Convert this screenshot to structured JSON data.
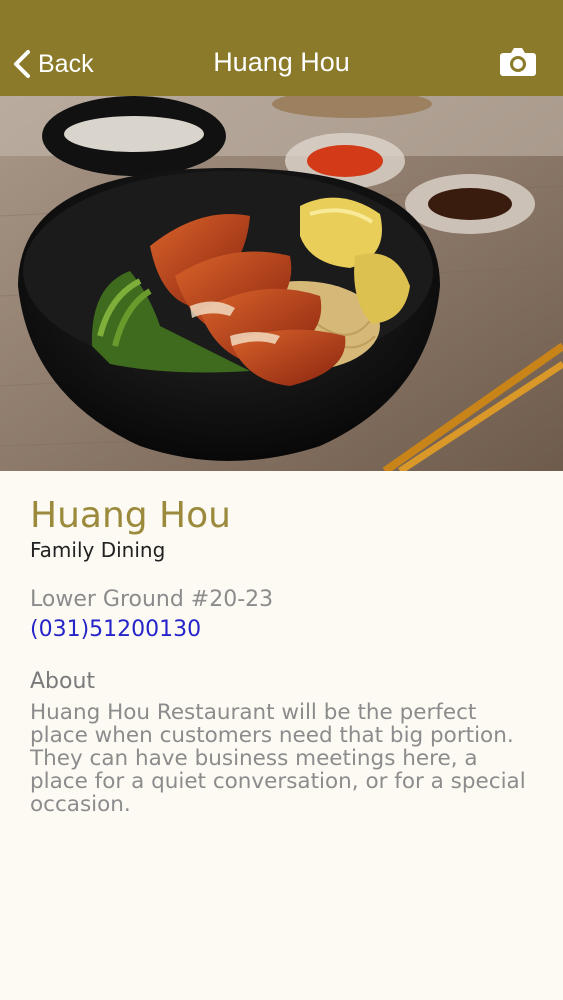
{
  "navbar": {
    "back_label": "Back",
    "title": "Huang Hou",
    "camera_icon": "camera-icon",
    "background_color": "#8a7a2a"
  },
  "hero": {
    "image": "bowl of roast duck noodles with dumplings and greens"
  },
  "restaurant": {
    "name": "Huang Hou",
    "category": "Family Dining",
    "location": "Lower Ground #20-23",
    "phone": "(031)51200130",
    "about_heading": "About",
    "about_text": "Huang Hou Restaurant will be the perfect place when customers need that big portion. They can have business meetings here, a place for a quiet conversation, or for a special occasion."
  },
  "colors": {
    "name": "#9b8a3c",
    "phone_link": "#2424c8",
    "page_background": "#fdfaf4"
  }
}
